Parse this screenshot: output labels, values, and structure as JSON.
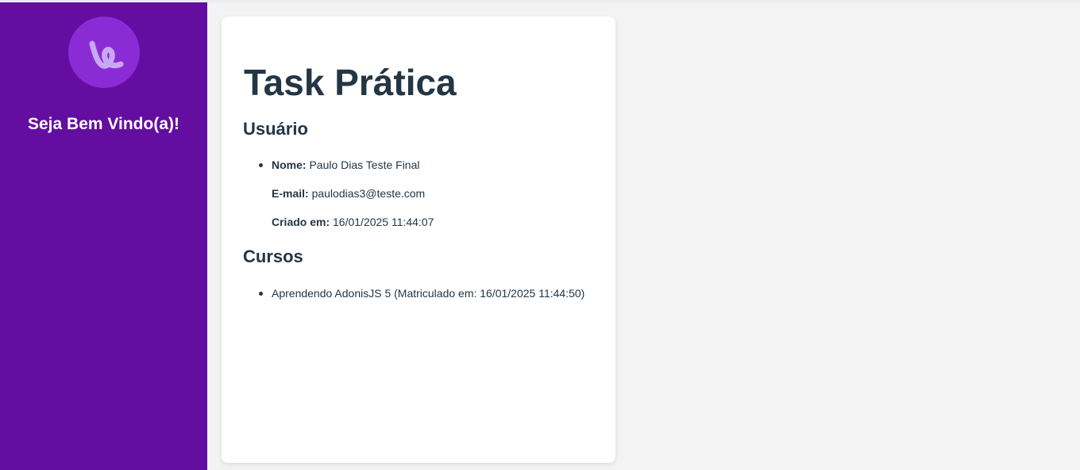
{
  "sidebar": {
    "logo_icon": "v-logo-icon",
    "welcome": "Seja Bem Vindo(a)!"
  },
  "main": {
    "title": "Task Prática",
    "user_section": {
      "heading": "Usuário",
      "name_label": "Nome:",
      "name_value": "Paulo Dias Teste Final",
      "email_label": "E-mail:",
      "email_value": "paulodias3@teste.com",
      "created_label": "Criado em:",
      "created_value": "16/01/2025 11:44:07"
    },
    "courses_section": {
      "heading": "Cursos",
      "items": [
        "Aprendendo AdonisJS 5 (Matriculado em: 16/01/2025 11:44:50)"
      ]
    }
  },
  "colors": {
    "sidebar_bg": "#640da1",
    "logo_bg": "#8a2cd6",
    "logo_stroke": "#c9a8f2",
    "text_dark": "#243645",
    "page_bg": "#f3f3f4"
  }
}
